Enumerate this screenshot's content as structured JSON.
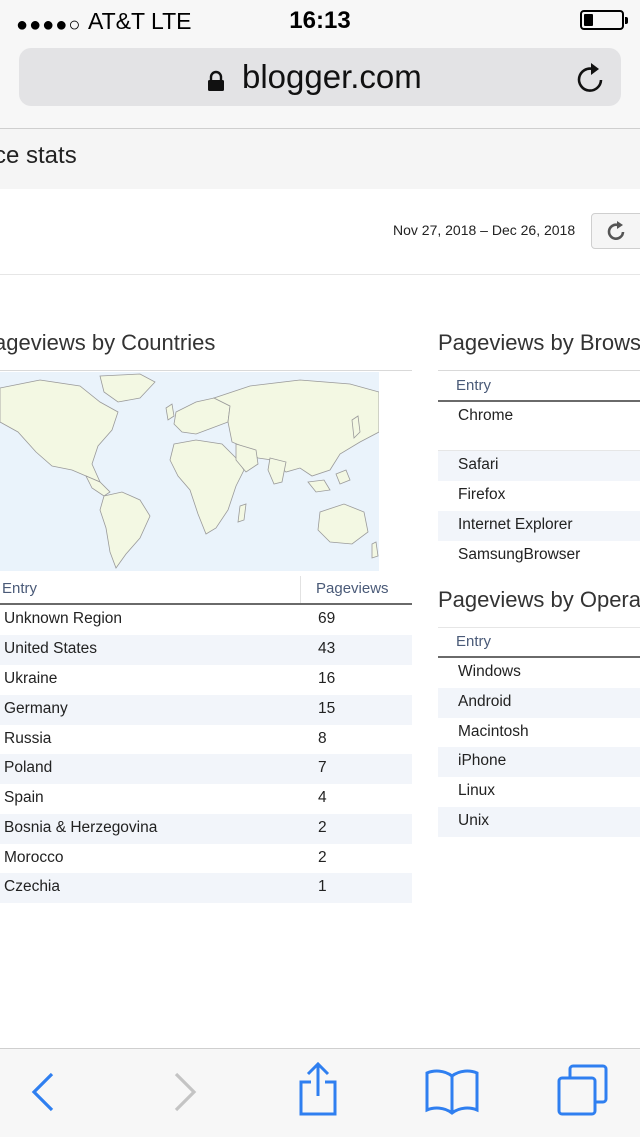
{
  "status_bar": {
    "signal": "●●●●○",
    "carrier": "AT&T  LTE",
    "time": "16:13"
  },
  "browser": {
    "url": "blogger.com"
  },
  "page": {
    "title": "ce stats",
    "date_range": "Nov 27, 2018 – Dec 26, 2018"
  },
  "countries": {
    "heading": "ageviews by Countries",
    "col_entry": "Entry",
    "col_pageviews": "Pageviews",
    "rows": [
      {
        "name": "Unknown Region",
        "value": "69"
      },
      {
        "name": "United States",
        "value": "43"
      },
      {
        "name": "Ukraine",
        "value": "16"
      },
      {
        "name": "Germany",
        "value": "15"
      },
      {
        "name": "Russia",
        "value": "8"
      },
      {
        "name": "Poland",
        "value": "7"
      },
      {
        "name": "Spain",
        "value": "4"
      },
      {
        "name": "Bosnia & Herzegovina",
        "value": "2"
      },
      {
        "name": "Morocco",
        "value": "2"
      },
      {
        "name": "Czechia",
        "value": "1"
      }
    ]
  },
  "browsers": {
    "heading": "Pageviews by Brows",
    "col_entry": "Entry",
    "rows": [
      "Chrome",
      "Safari",
      "Firefox",
      "Internet Explorer",
      "SamsungBrowser"
    ]
  },
  "os": {
    "heading": "Pageviews by Opera",
    "col_entry": "Entry",
    "rows": [
      "Windows",
      "Android",
      "Macintosh",
      "iPhone",
      "Linux",
      "Unix"
    ]
  },
  "colors": {
    "accent": "#2f7ff0",
    "disabled": "#c4c4c4",
    "map_land": "#f3f8e3",
    "map_water": "#eaf3fb"
  }
}
